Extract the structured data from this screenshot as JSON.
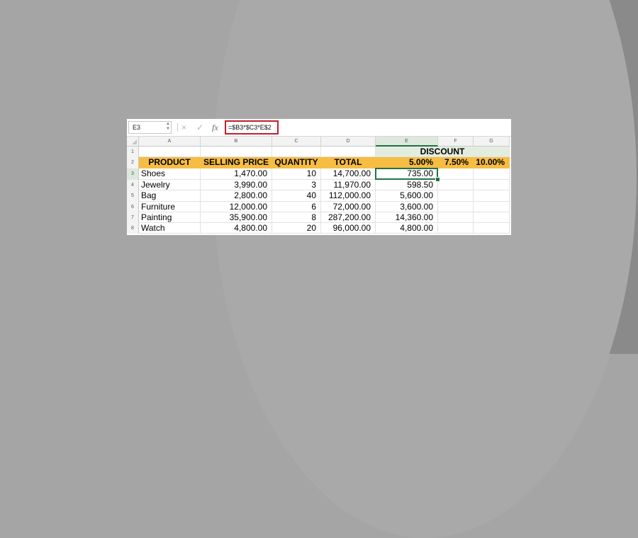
{
  "formula_bar": {
    "name_box": "E3",
    "formula": "=$B3*$C3*E$2",
    "cancel_icon": "×",
    "enter_icon": "✓",
    "fx_label": "fx"
  },
  "columns": [
    "A",
    "B",
    "C",
    "D",
    "E",
    "F",
    "G"
  ],
  "selected_column": "E",
  "rows": [
    {
      "num": "1",
      "cells": [
        "",
        "",
        "",
        "",
        "DISCOUNT",
        "",
        ""
      ]
    },
    {
      "num": "2",
      "cells": [
        "PRODUCT",
        "SELLING PRICE",
        "QUANTITY",
        "TOTAL",
        "5.00%",
        "7.50%",
        "10.00%"
      ]
    },
    {
      "num": "3",
      "cells": [
        "Shoes",
        "1,470.00",
        "10",
        "14,700.00",
        "735.00",
        "",
        ""
      ]
    },
    {
      "num": "4",
      "cells": [
        "Jewelry",
        "3,990.00",
        "3",
        "11,970.00",
        "598.50",
        "",
        ""
      ]
    },
    {
      "num": "5",
      "cells": [
        "Bag",
        "2,800.00",
        "40",
        "112,000.00",
        "5,600.00",
        "",
        ""
      ]
    },
    {
      "num": "6",
      "cells": [
        "Furniture",
        "12,000.00",
        "6",
        "72,000.00",
        "3,600.00",
        "",
        ""
      ]
    },
    {
      "num": "7",
      "cells": [
        "Painting",
        "35,900.00",
        "8",
        "287,200.00",
        "14,360.00",
        "",
        ""
      ]
    },
    {
      "num": "8",
      "cells": [
        "Watch",
        "4,800.00",
        "20",
        "96,000.00",
        "4,800.00",
        "",
        ""
      ]
    }
  ],
  "active_cell": {
    "col": "E",
    "row": "3"
  },
  "colors": {
    "header_fill": "#f6bd42",
    "discount_fill": "#e3eddf",
    "selection": "#217346",
    "formula_highlight": "#c0202a"
  }
}
